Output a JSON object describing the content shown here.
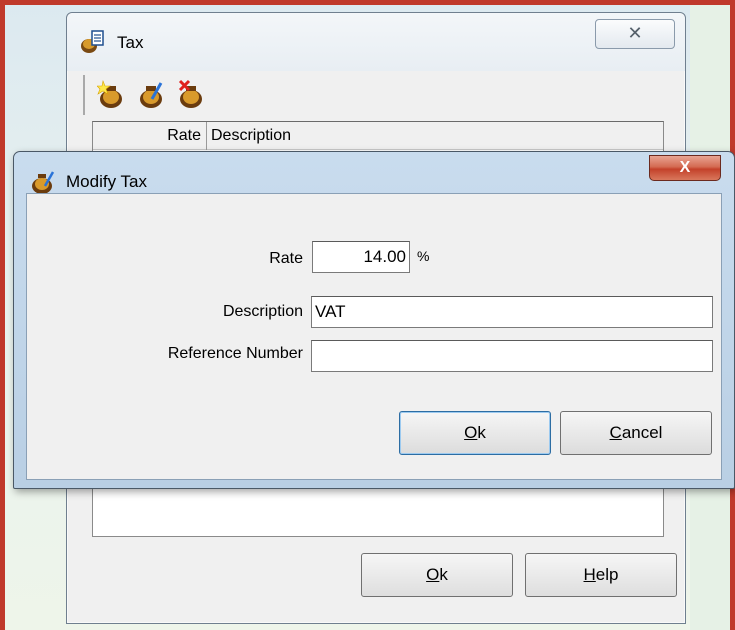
{
  "tax_window": {
    "title": "Tax",
    "toolbar": [
      "add-tax-icon",
      "modify-tax-icon",
      "delete-tax-icon"
    ],
    "columns": [
      "Rate",
      "Description"
    ],
    "ok_mnemonic": "O",
    "ok_rest": "k",
    "help_mnemonic": "H",
    "help_rest": "elp"
  },
  "modify_dialog": {
    "title": "Modify Tax",
    "close_label": "X",
    "rate_label": "Rate",
    "rate_value": "14.00",
    "rate_unit": "%",
    "description_label": "Description",
    "description_value": "VAT",
    "reference_label": "Reference Number",
    "reference_value": "",
    "ok_mnemonic": "O",
    "ok_rest": "k",
    "cancel_mnemonic": "C",
    "cancel_rest": "ancel"
  },
  "colors": {
    "border_accent": "#c0392b",
    "close_button": "#c4412a"
  }
}
